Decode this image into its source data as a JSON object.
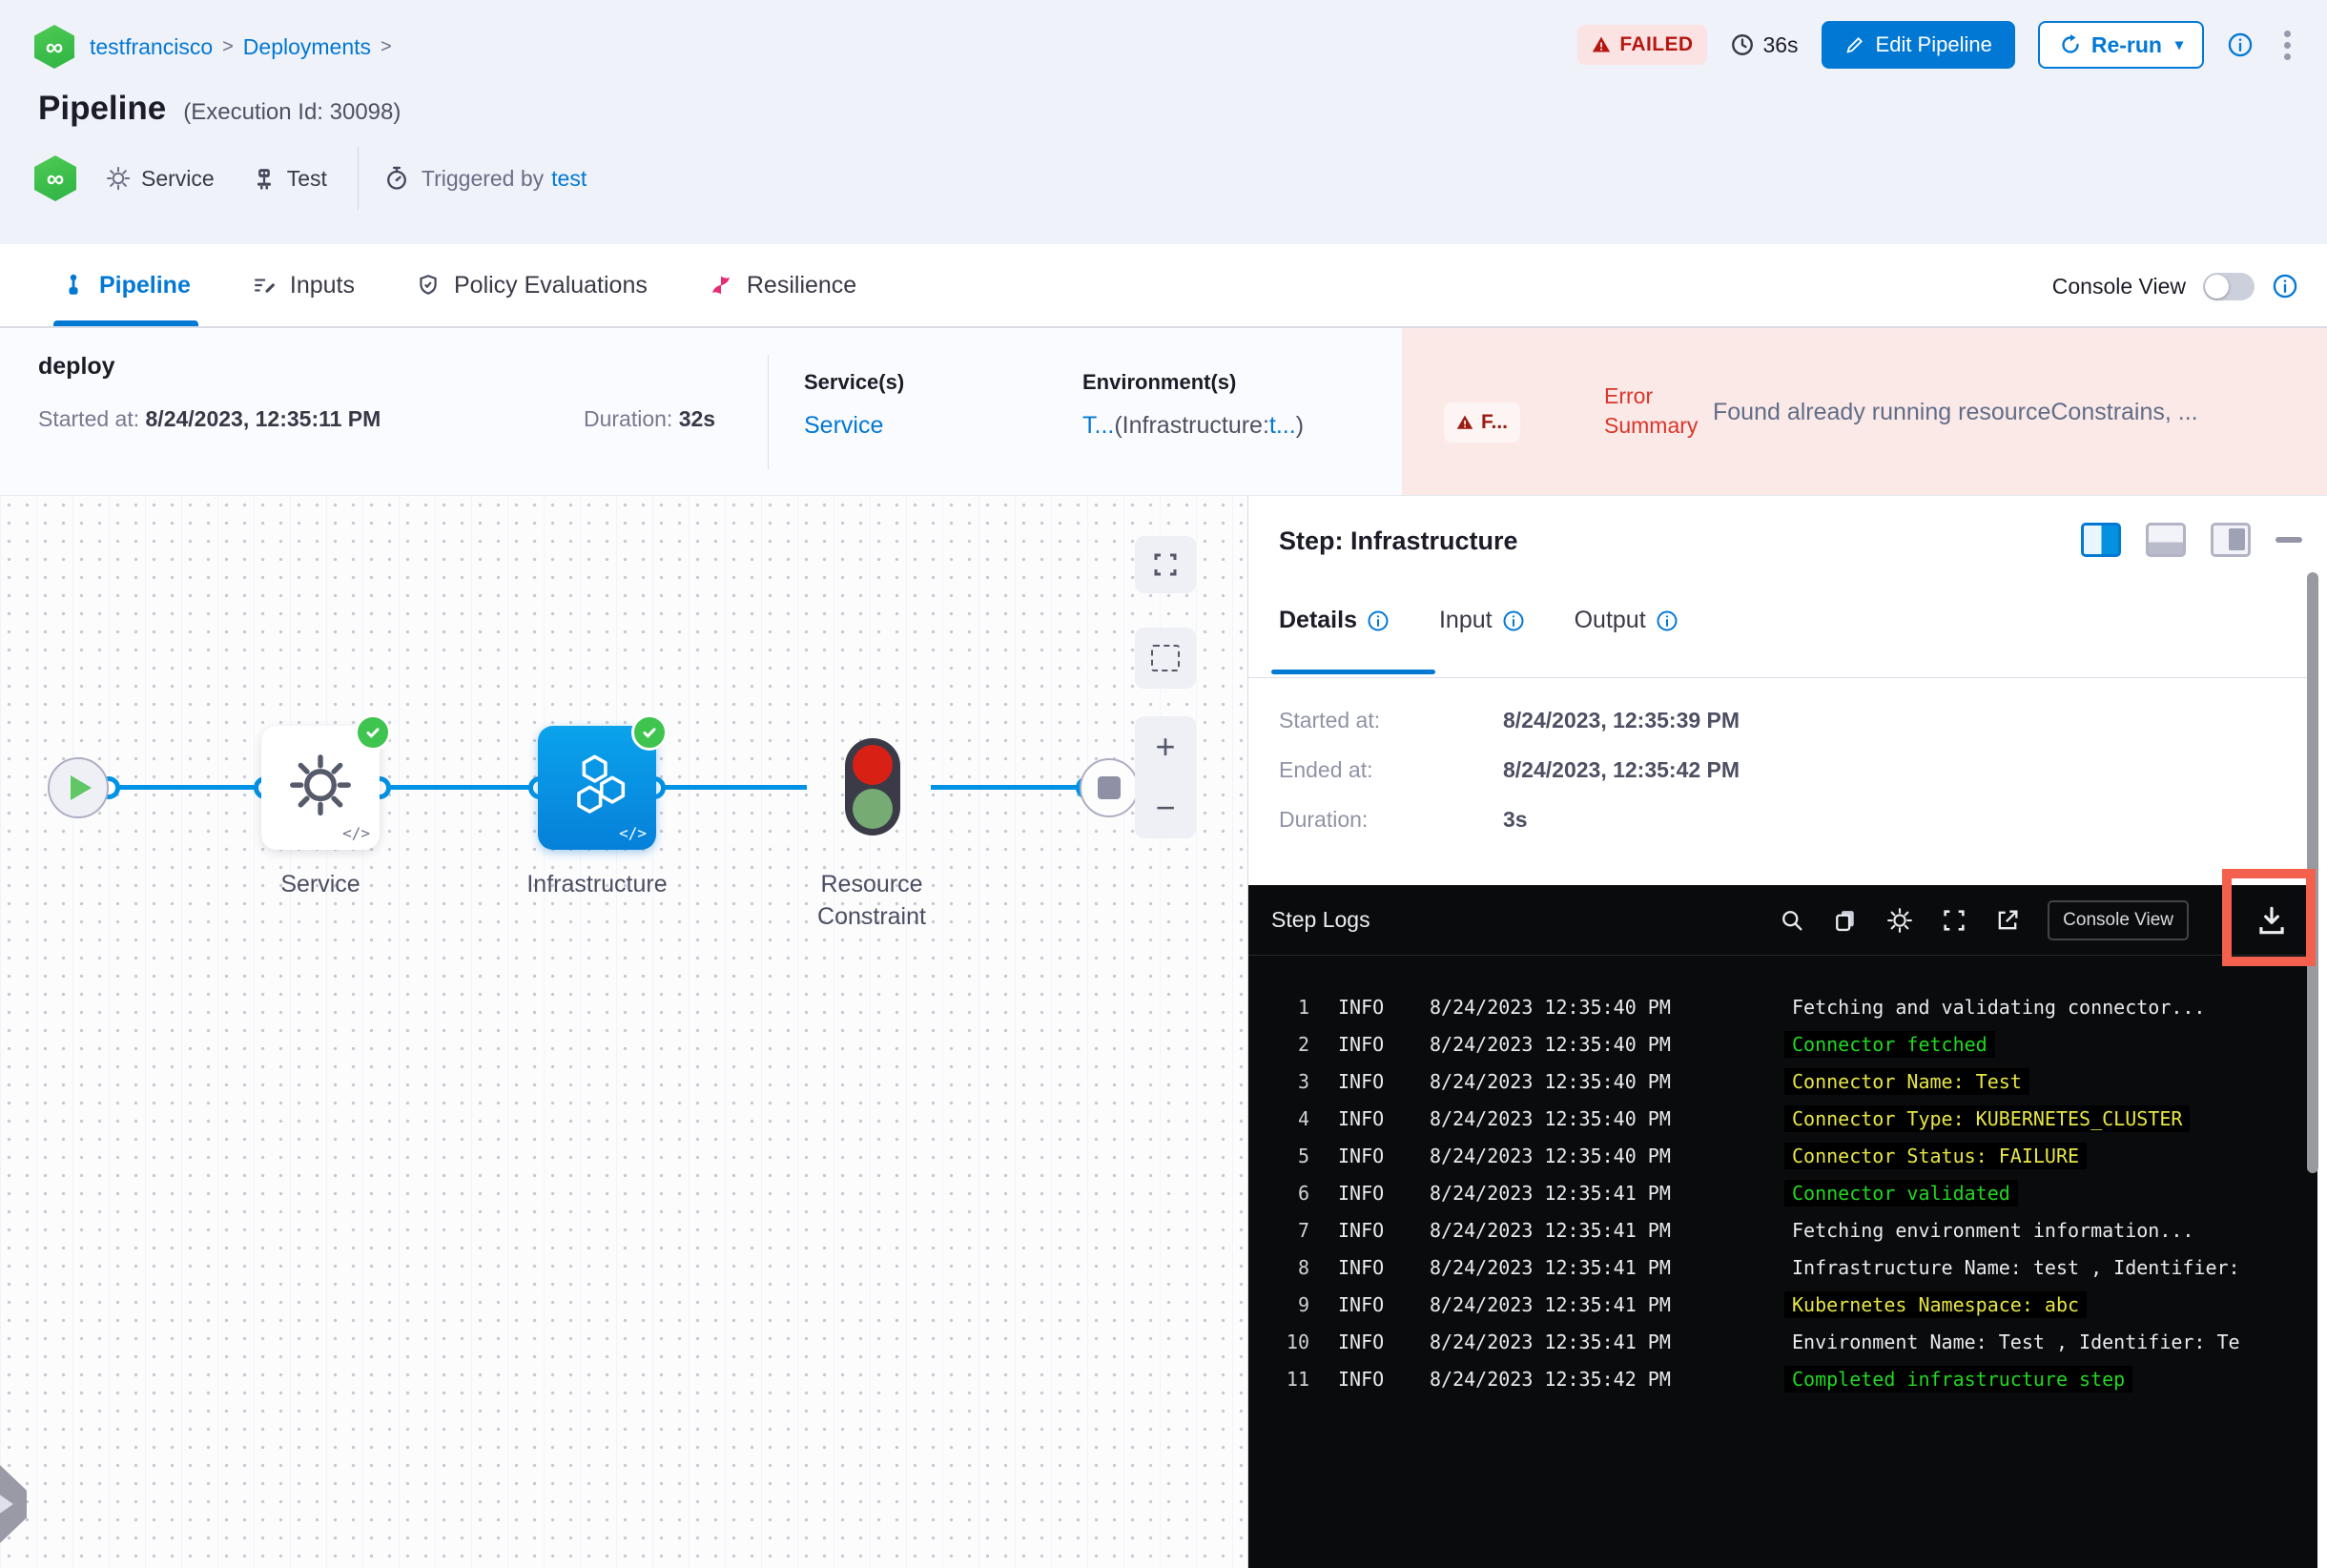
{
  "colors": {
    "primary_blue": "#0278d5",
    "node_blue": "#0092e4",
    "success_green": "#3fc44f",
    "failed_red": "#b41710",
    "error_bg_pink": "#fbe9e7",
    "annotation_red": "#f4604e",
    "logs_bg": "#0a0b0d",
    "log_green": "#21d821",
    "log_yellow": "#e6e645"
  },
  "icons": {
    "harness_logo": "∞",
    "caret_down": "▾"
  },
  "breadcrumb": {
    "project": "testfrancisco",
    "section": "Deployments",
    "separator": ">"
  },
  "header": {
    "title": "Pipeline",
    "execution_id": "(Execution Id: 30098)",
    "status_badge": "FAILED",
    "total_duration": "36s",
    "edit_pipeline_button": "Edit Pipeline",
    "rerun_button": "Re-run",
    "service_label": "Service",
    "test_label": "Test",
    "triggered_by_label": "Triggered by",
    "triggered_by_user": "test"
  },
  "tabs": {
    "pipeline": "Pipeline",
    "inputs": "Inputs",
    "policy_evaluations": "Policy Evaluations",
    "resilience": "Resilience",
    "console_view_label": "Console View"
  },
  "summary": {
    "stage_name": "deploy",
    "started_label": "Started at:",
    "started_value": "8/24/2023, 12:35:11 PM",
    "duration_label": "Duration:",
    "duration_value": "32s",
    "services_label": "Service(s)",
    "service_link": "Service",
    "environments_label": "Environment(s)",
    "environment_link": "T...",
    "environment_infra_prefix": "(Infrastructure:",
    "environment_infra_link": "t...",
    "environment_suffix": ")",
    "error_badge": "F...",
    "error_summary_label": "Error Summary",
    "error_message": "Found already running resourceConstrains, ..."
  },
  "graph": {
    "node_service": "Service",
    "node_infrastructure": "Infrastructure",
    "node_resource_constraint": "Resource Constraint",
    "code_icon_label": "</>",
    "zoom_in": "+",
    "zoom_out": "−"
  },
  "step_panel": {
    "title": "Step: Infrastructure",
    "tab_details": "Details",
    "tab_input": "Input",
    "tab_output": "Output",
    "fields": [
      {
        "label": "Started at:",
        "value": "8/24/2023, 12:35:39 PM"
      },
      {
        "label": "Ended at:",
        "value": "8/24/2023, 12:35:42 PM"
      },
      {
        "label": "Duration:",
        "value": "3s"
      }
    ]
  },
  "step_logs": {
    "title": "Step Logs",
    "console_view_button": "Console View",
    "lines": [
      {
        "num": "1",
        "level": "INFO",
        "time": "8/24/2023 12:35:40 PM",
        "msg": "Fetching and validating connector...",
        "color": "white"
      },
      {
        "num": "2",
        "level": "INFO",
        "time": "8/24/2023 12:35:40 PM",
        "msg": "Connector fetched",
        "color": "green"
      },
      {
        "num": "3",
        "level": "INFO",
        "time": "8/24/2023 12:35:40 PM",
        "msg": "Connector Name: Test",
        "color": "yellow"
      },
      {
        "num": "4",
        "level": "INFO",
        "time": "8/24/2023 12:35:40 PM",
        "msg": "Connector Type: KUBERNETES_CLUSTER",
        "color": "yellow"
      },
      {
        "num": "5",
        "level": "INFO",
        "time": "8/24/2023 12:35:40 PM",
        "msg": "Connector Status: FAILURE",
        "color": "yellow"
      },
      {
        "num": "6",
        "level": "INFO",
        "time": "8/24/2023 12:35:41 PM",
        "msg": "Connector validated",
        "color": "green"
      },
      {
        "num": "7",
        "level": "INFO",
        "time": "8/24/2023 12:35:41 PM",
        "msg": "Fetching environment information...",
        "color": "white"
      },
      {
        "num": "8",
        "level": "INFO",
        "time": "8/24/2023 12:35:41 PM",
        "msg": "Infrastructure Name: test , Identifier:",
        "color": "white"
      },
      {
        "num": "9",
        "level": "INFO",
        "time": "8/24/2023 12:35:41 PM",
        "msg": "Kubernetes Namespace: abc",
        "color": "yellow"
      },
      {
        "num": "10",
        "level": "INFO",
        "time": "8/24/2023 12:35:41 PM",
        "msg": "Environment Name: Test , Identifier: Te",
        "color": "white"
      },
      {
        "num": "11",
        "level": "INFO",
        "time": "8/24/2023 12:35:42 PM",
        "msg": "Completed infrastructure step",
        "color": "green"
      }
    ]
  }
}
